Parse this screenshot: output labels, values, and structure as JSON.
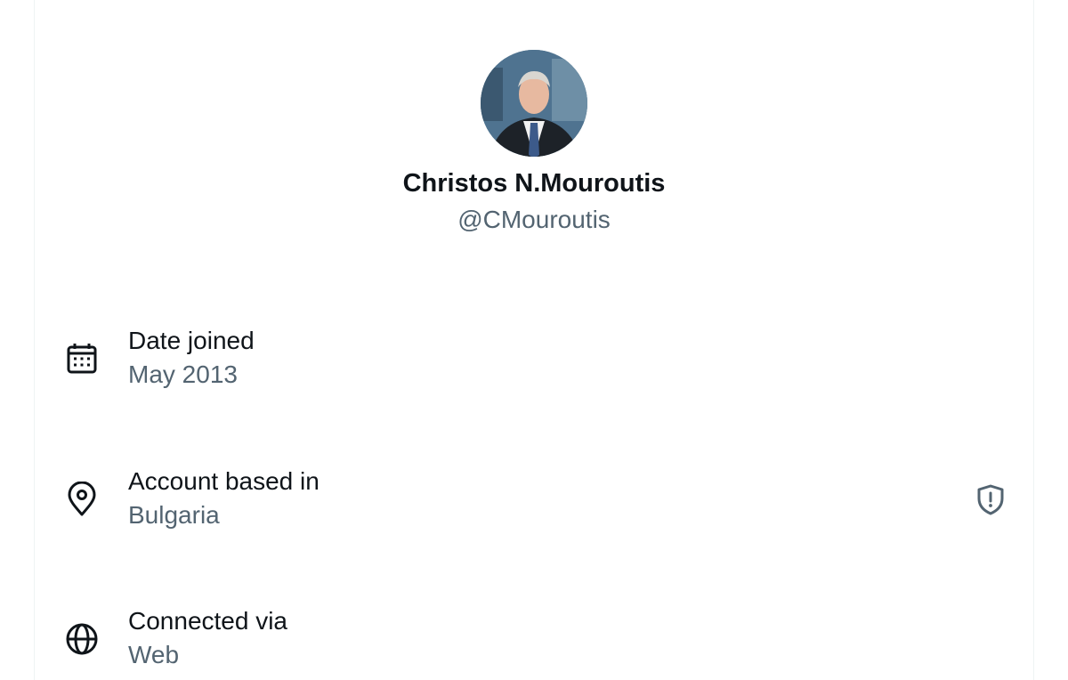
{
  "profile": {
    "display_name": "Christos N.Mouroutis",
    "handle": "@CMouroutis"
  },
  "details": [
    {
      "icon": "calendar-icon",
      "label": "Date joined",
      "value": "May 2013"
    },
    {
      "icon": "location-pin-icon",
      "label": "Account based in",
      "value": "Bulgaria",
      "side_icon": "shield-alert-icon"
    },
    {
      "icon": "globe-icon",
      "label": "Connected via",
      "value": "Web"
    }
  ],
  "colors": {
    "primary_text": "#0f1419",
    "secondary_text": "#536471",
    "accent_shield": "#536471"
  }
}
